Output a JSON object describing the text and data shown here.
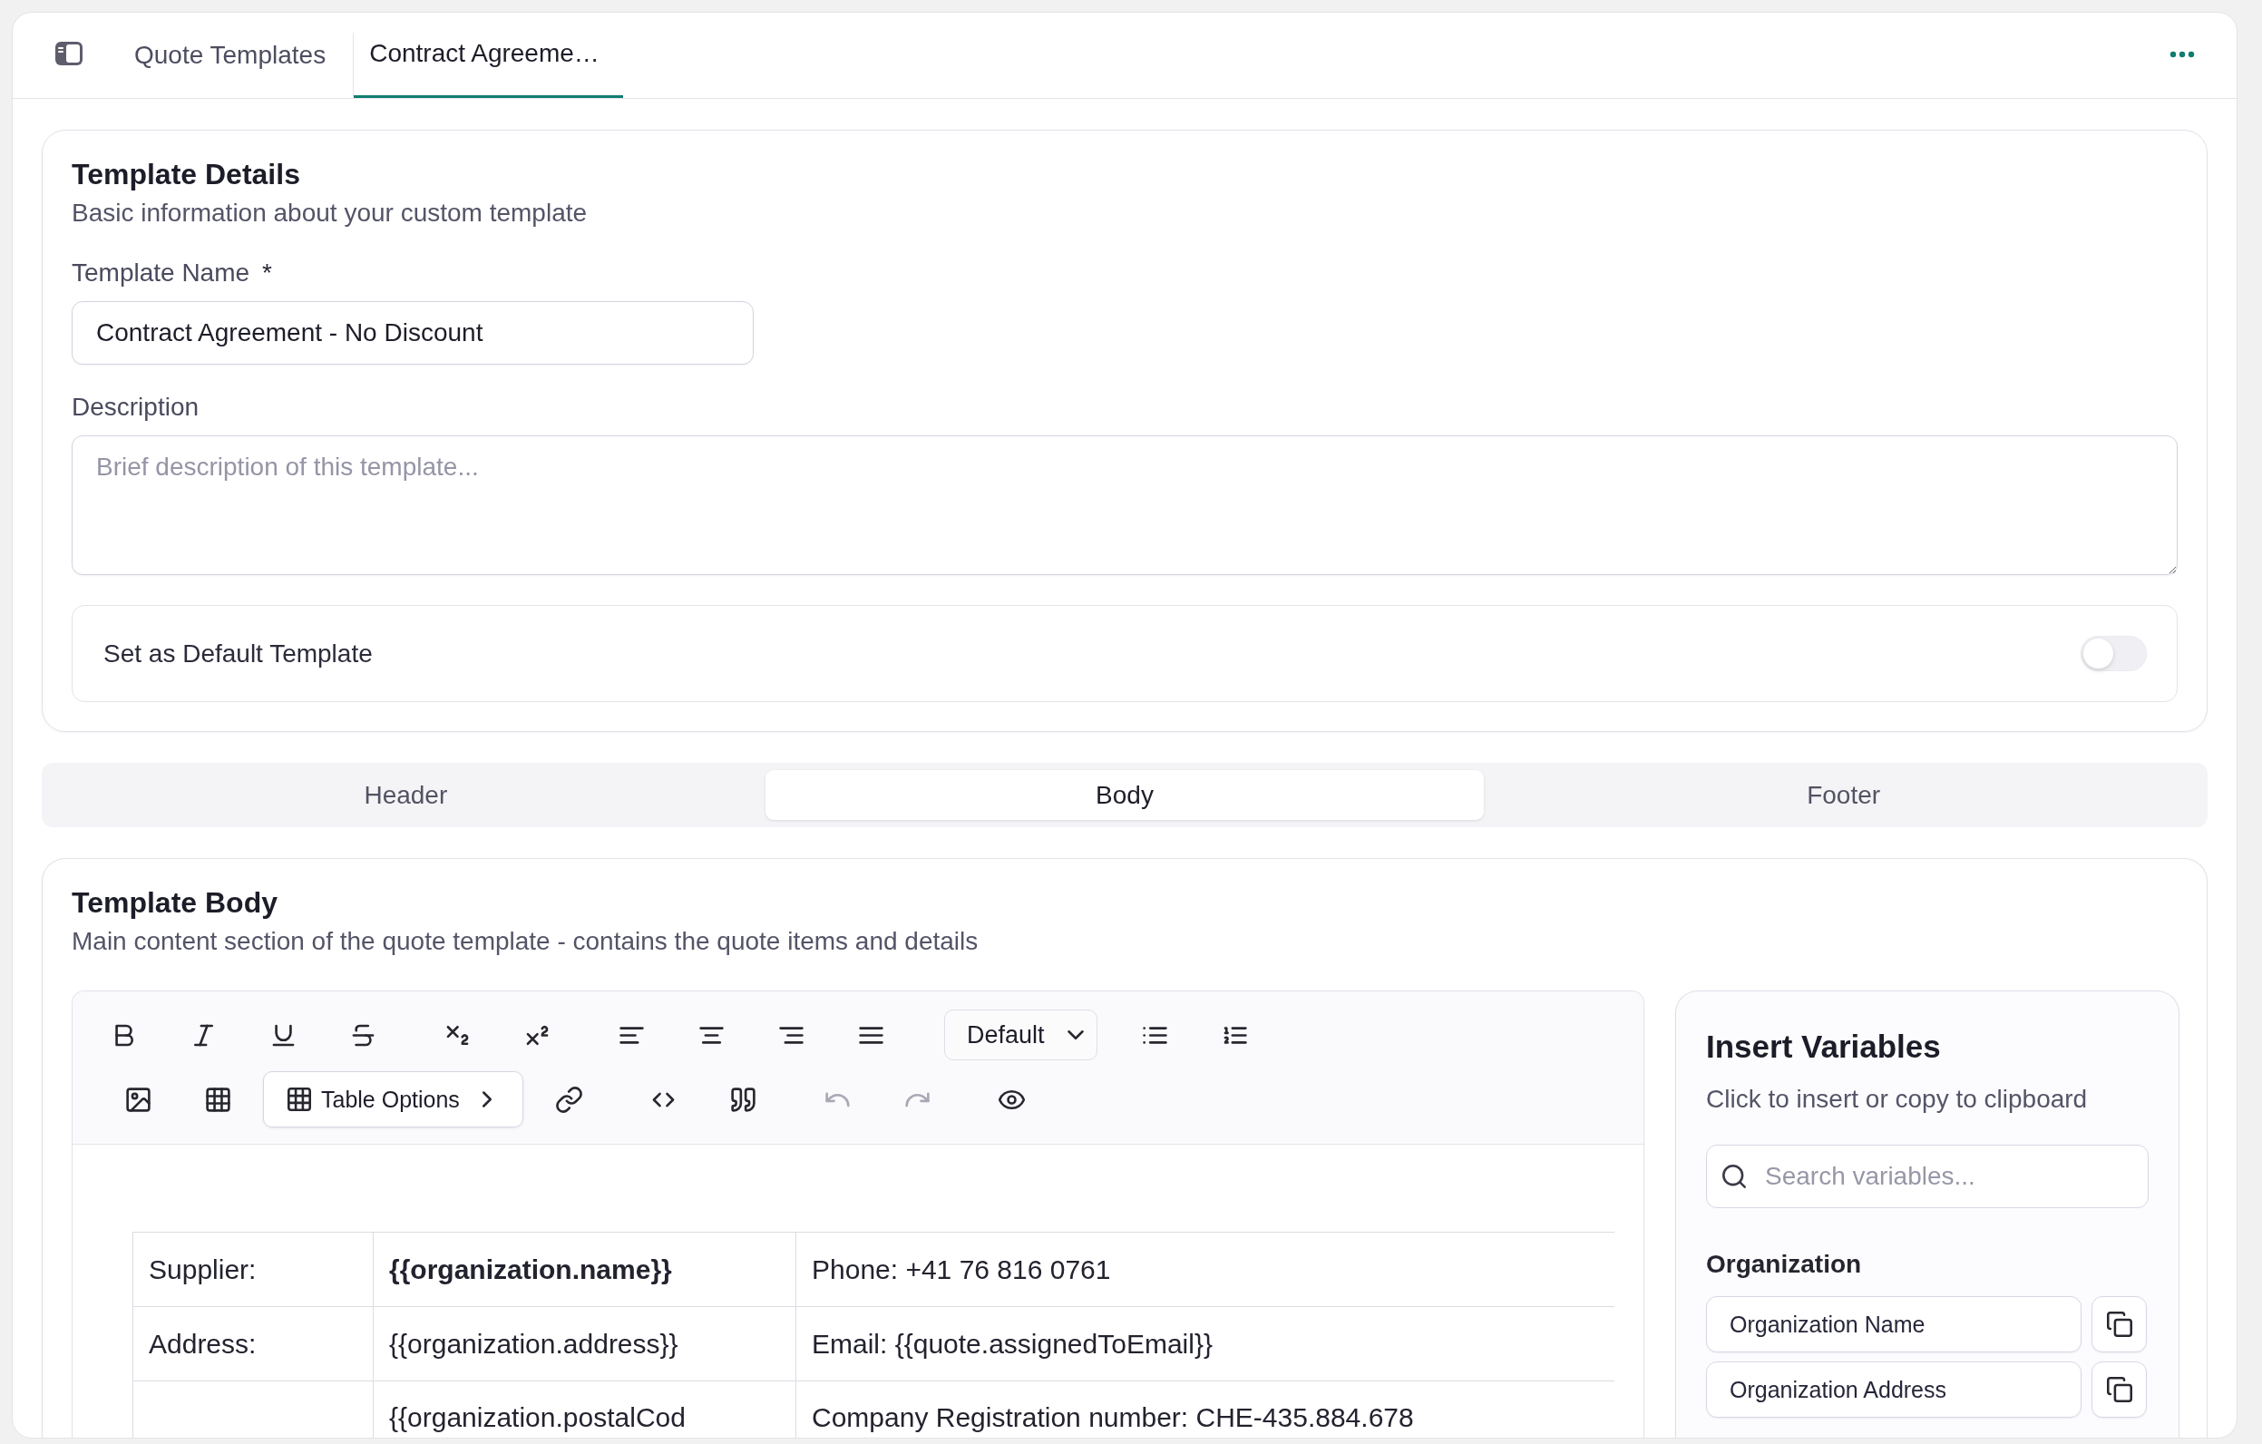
{
  "top_bar": {
    "tabs": [
      {
        "label": "Quote Templates",
        "selected": false
      },
      {
        "label": "Contract Agreeme…",
        "selected": true
      }
    ]
  },
  "template_details": {
    "title": "Template Details",
    "subtitle": "Basic information about your custom template",
    "name_field": {
      "label": "Template Name",
      "required_mark": "*",
      "value": "Contract Agreement - No Discount"
    },
    "description_field": {
      "label": "Description",
      "placeholder": "Brief description of this template..."
    },
    "default_toggle": {
      "label": "Set as Default Template",
      "on": false
    }
  },
  "section_tabs": [
    {
      "label": "Header",
      "selected": false
    },
    {
      "label": "Body",
      "selected": true
    },
    {
      "label": "Footer",
      "selected": false
    }
  ],
  "template_body": {
    "title": "Template Body",
    "subtitle": "Main content section of the quote template - contains the quote items and details",
    "editor": {
      "toolbar": [
        {
          "groups": [
            [
              {
                "kind": "bold",
                "disabled": false
              },
              {
                "kind": "italic",
                "disabled": false
              },
              {
                "kind": "underline",
                "disabled": false
              },
              {
                "kind": "strikethrough",
                "disabled": false
              }
            ],
            [
              {
                "kind": "subscript",
                "disabled": false
              },
              {
                "kind": "superscript",
                "disabled": false
              }
            ],
            [
              {
                "kind": "align-left",
                "disabled": false
              },
              {
                "kind": "align-center",
                "disabled": false
              },
              {
                "kind": "align-right",
                "disabled": false
              },
              {
                "kind": "align-justify",
                "disabled": false
              }
            ],
            [
              {
                "kind": "select",
                "value": "Default",
                "disabled": false
              }
            ],
            [
              {
                "kind": "bullet-list",
                "disabled": false
              },
              {
                "kind": "numbered-list",
                "disabled": false
              }
            ]
          ]
        },
        {
          "groups": [
            [
              {
                "kind": "image",
                "disabled": false
              },
              {
                "kind": "table",
                "disabled": false
              },
              {
                "kind": "menu",
                "label": "Table Options",
                "disabled": false
              },
              {
                "kind": "link",
                "disabled": false
              }
            ],
            [
              {
                "kind": "code",
                "disabled": false
              },
              {
                "kind": "quote",
                "disabled": false
              }
            ],
            [
              {
                "kind": "undo",
                "disabled": true
              },
              {
                "kind": "redo",
                "disabled": true
              }
            ],
            [
              {
                "kind": "preview",
                "disabled": false
              }
            ]
          ]
        }
      ],
      "table": {
        "rows": [
          {
            "column_1": {
              "text": "Supplier:",
              "bold": false
            },
            "column_2": {
              "text": "{{organization.name}}",
              "bold": true
            },
            "column_3": {
              "text": "Phone: +41 76 816 0761",
              "bold": false
            }
          },
          {
            "column_1": {
              "text": "Address:",
              "bold": false
            },
            "column_2": {
              "text": "{{organization.address}}",
              "bold": false
            },
            "column_3": {
              "text": "Email: {{quote.assignedToEmail}}",
              "bold": false
            }
          },
          {
            "column_2": {
              "text": "{{organization.postalCod",
              "bold": false
            },
            "column_3": {
              "text": "Company Registration number: CHE-435.884.678",
              "bold": false
            }
          }
        ]
      }
    },
    "variables": {
      "title": "Insert Variables",
      "subtitle": "Click to insert or copy to clipboard",
      "search": {
        "placeholder": "Search variables..."
      },
      "groups": [
        {
          "title": "Organization",
          "items": [
            {
              "label": "Organization Name"
            },
            {
              "label": "Organization Address"
            }
          ]
        }
      ]
    }
  }
}
